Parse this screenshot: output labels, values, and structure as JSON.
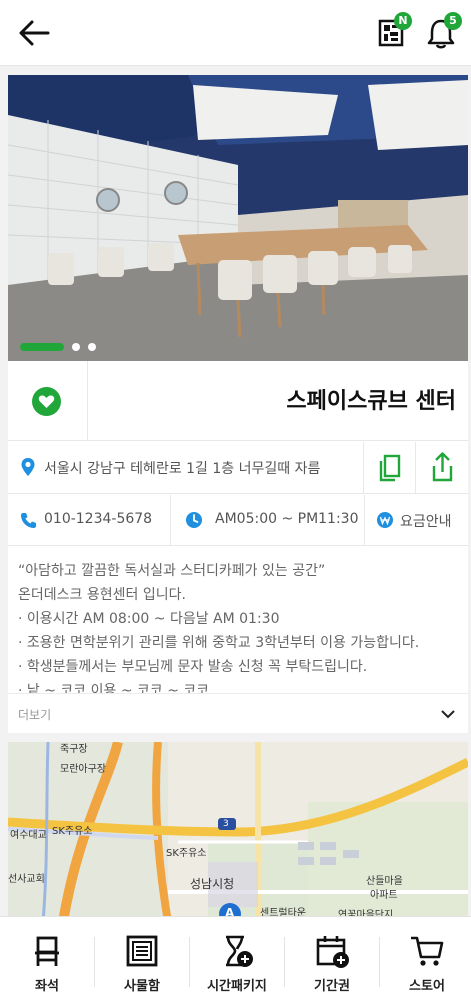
{
  "header": {
    "back_icon": "arrow-left-icon",
    "qr_icon": "qr-code-icon",
    "qr_badge": "N",
    "bell_icon": "bell-icon",
    "bell_badge": "5",
    "accent": "#21a63a"
  },
  "carousel": {
    "total": 3,
    "active": 1
  },
  "place": {
    "name": "스페이스큐브 센터",
    "address": "서울시 강남구 테헤란로 1길 1층 너무길때 자름",
    "phone": "010-1234-5678",
    "hours": "AM05:00 ~ PM11:30",
    "fee_label": "요금안내"
  },
  "description": {
    "lines": [
      "“아담하고 깔끔한 독서실과 스터디카페가 있는 공간”",
      "온더데스크 용현센터 입니다.",
      "· 이용시간 AM 08:00 ~ 다음날 AM 01:30",
      "· 조용한 면학분위기 관리를 위해 중학교 3학년부터 이용 가능합니다.",
      "· 학생분들께서는 부모님께 문자 발송 신청 꼭 부탁드립니다.",
      "· 낱 ~ 코코 이용 ~ 코코 ~ 코코"
    ],
    "more_label": "더보기"
  },
  "map": {
    "labels": [
      "죽구장",
      "모란아구장",
      "SK주유소",
      "여수대교",
      "선사교회",
      "SK주유소",
      "성남시청",
      "산들마을",
      "아파트",
      "센트럴타운",
      "연꽃마을단지",
      "3",
      "A"
    ]
  },
  "tabs": [
    {
      "label": "좌석",
      "icon": "seat-icon"
    },
    {
      "label": "사물함",
      "icon": "locker-icon"
    },
    {
      "label": "시간패키지",
      "icon": "hourglass-plus-icon"
    },
    {
      "label": "기간권",
      "icon": "calendar-plus-icon"
    },
    {
      "label": "스토어",
      "icon": "cart-icon"
    }
  ]
}
